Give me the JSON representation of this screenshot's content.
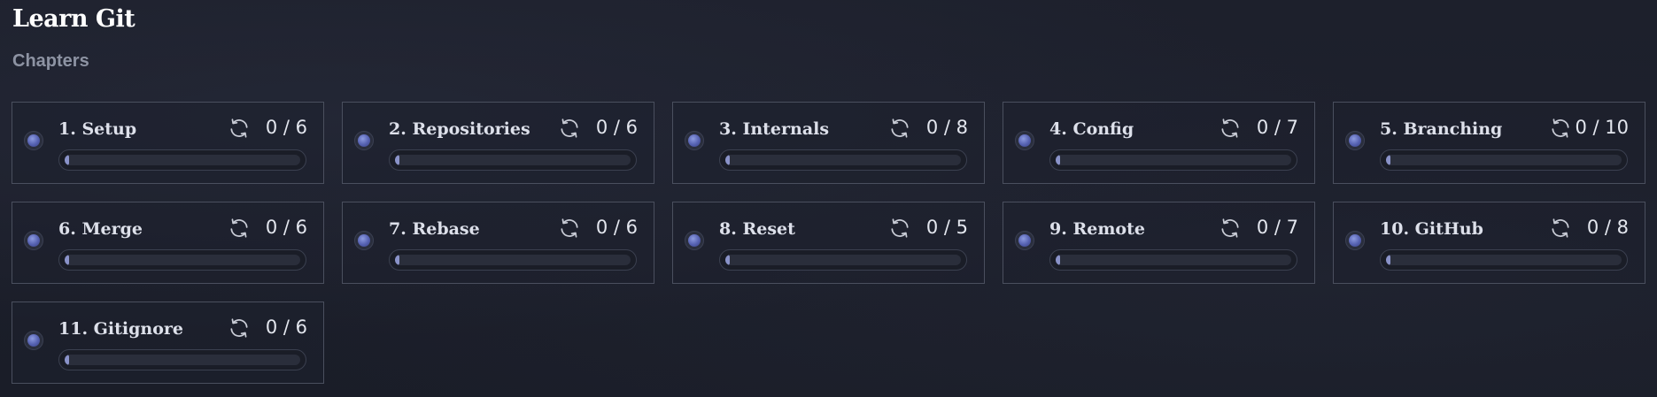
{
  "header": {
    "title": "Learn Git",
    "subtitle": "Chapters"
  },
  "colors": {
    "background": "#1c1f2b",
    "card_border": "#4a4f5e",
    "progress_fill": "#8a93c9",
    "status_dot": "#5460b0"
  },
  "chapters": [
    {
      "title": "1. Setup",
      "count": "0 / 6",
      "progress": 0,
      "icon": "refresh-icon"
    },
    {
      "title": "2. Repositories",
      "count": "0 / 6",
      "progress": 0,
      "icon": "refresh-icon"
    },
    {
      "title": "3. Internals",
      "count": "0 / 8",
      "progress": 0,
      "icon": "refresh-icon"
    },
    {
      "title": "4. Config",
      "count": "0 / 7",
      "progress": 0,
      "icon": "refresh-icon"
    },
    {
      "title": "5. Branching",
      "count": "0 / 10",
      "progress": 0,
      "icon": "refresh-icon"
    },
    {
      "title": "6. Merge",
      "count": "0 / 6",
      "progress": 0,
      "icon": "refresh-icon"
    },
    {
      "title": "7. Rebase",
      "count": "0 / 6",
      "progress": 0,
      "icon": "refresh-icon"
    },
    {
      "title": "8. Reset",
      "count": "0 / 5",
      "progress": 0,
      "icon": "refresh-icon"
    },
    {
      "title": "9. Remote",
      "count": "0 / 7",
      "progress": 0,
      "icon": "refresh-icon"
    },
    {
      "title": "10. GitHub",
      "count": "0 / 8",
      "progress": 0,
      "icon": "refresh-icon"
    },
    {
      "title": "11. Gitignore",
      "count": "0 / 6",
      "progress": 0,
      "icon": "refresh-icon"
    }
  ]
}
